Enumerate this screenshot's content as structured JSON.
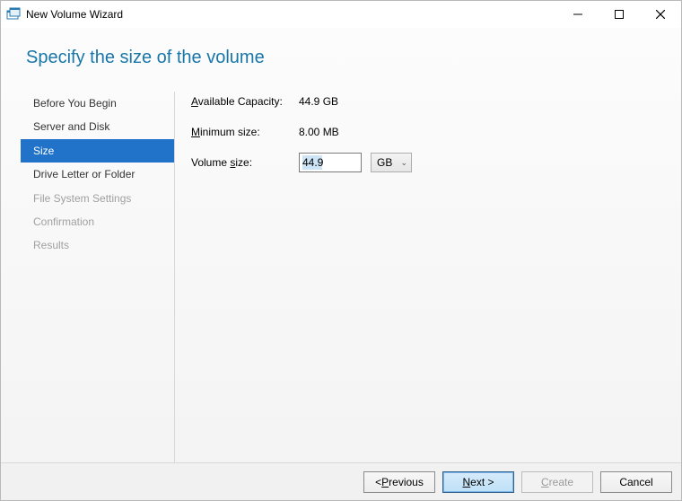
{
  "window": {
    "title": "New Volume Wizard"
  },
  "heading": "Specify the size of the volume",
  "steps": [
    {
      "label": "Before You Begin",
      "state": "normal"
    },
    {
      "label": "Server and Disk",
      "state": "normal"
    },
    {
      "label": "Size",
      "state": "active"
    },
    {
      "label": "Drive Letter or Folder",
      "state": "normal"
    },
    {
      "label": "File System Settings",
      "state": "disabled"
    },
    {
      "label": "Confirmation",
      "state": "disabled"
    },
    {
      "label": "Results",
      "state": "disabled"
    }
  ],
  "form": {
    "available_label_pre": "A",
    "available_label_post": "vailable Capacity:",
    "available_value": "44.9 GB",
    "minimum_label_pre": "M",
    "minimum_label_post": "inimum size:",
    "minimum_value": "8.00 MB",
    "volume_label_pre": "Volume ",
    "volume_label_u": "s",
    "volume_label_post": "ize:",
    "volume_value": "44.9",
    "unit": "GB"
  },
  "buttons": {
    "previous_pre": "< ",
    "previous_u": "P",
    "previous_post": "revious",
    "next_u": "N",
    "next_post": "ext >",
    "create_u": "C",
    "create_post": "reate",
    "cancel": "Cancel"
  }
}
